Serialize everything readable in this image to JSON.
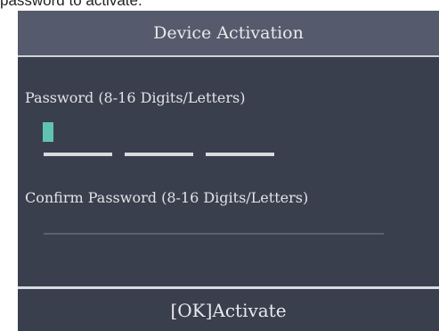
{
  "caption": "password to activate.",
  "title": "Device Activation",
  "password_field": {
    "label": "Password (8-16 Digits/Letters)",
    "value": ""
  },
  "confirm_field": {
    "label": "Confirm Password (8-16 Digits/Letters)",
    "value": ""
  },
  "footer": {
    "action_label": "[OK]Activate"
  },
  "colors": {
    "screen_background": "#3a3f4e",
    "title_bar": "#555b6c",
    "cursor_accent": "#5fc4b2",
    "text": "#e2e3e6"
  }
}
